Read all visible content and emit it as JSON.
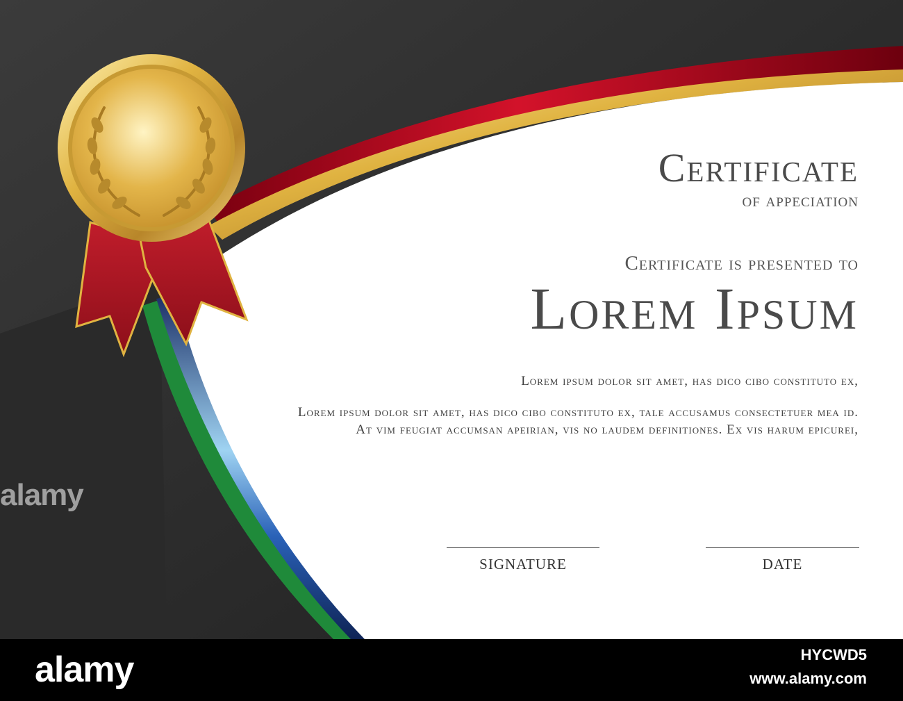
{
  "certificate": {
    "title": "Certificate",
    "subtitle": "of appeciation",
    "presented_to": "Certificate is presented to",
    "recipient": "Lorem Ipsum",
    "body_lines": [
      "Lorem ipsum dolor sit amet, has dico cibo constituto ex,",
      "Lorem ipsum dolor sit amet, has dico cibo constituto ex, tale accusamus consectetuer mea id.",
      "At vim feugiat accumsan apeirian, vis no laudem definitiones. Ex vis harum epicurei,"
    ],
    "signature_label": "SIGNATURE",
    "date_label": "DATE"
  },
  "watermark": {
    "side_text": "alamy"
  },
  "footer": {
    "logo": "alamy",
    "image_id": "HYCWD5",
    "url": "www.alamy.com"
  },
  "colors": {
    "dark_panel": "#333333",
    "paper": "#ffffff",
    "red_ribbon": "#b3001b",
    "gold": "#d9a530",
    "green": "#1f8a3a",
    "blue": "#13306e",
    "text": "#4a4a4a"
  },
  "icons": [
    "gold-medal-icon",
    "laurel-wreath-icon",
    "red-ribbon-icon"
  ]
}
